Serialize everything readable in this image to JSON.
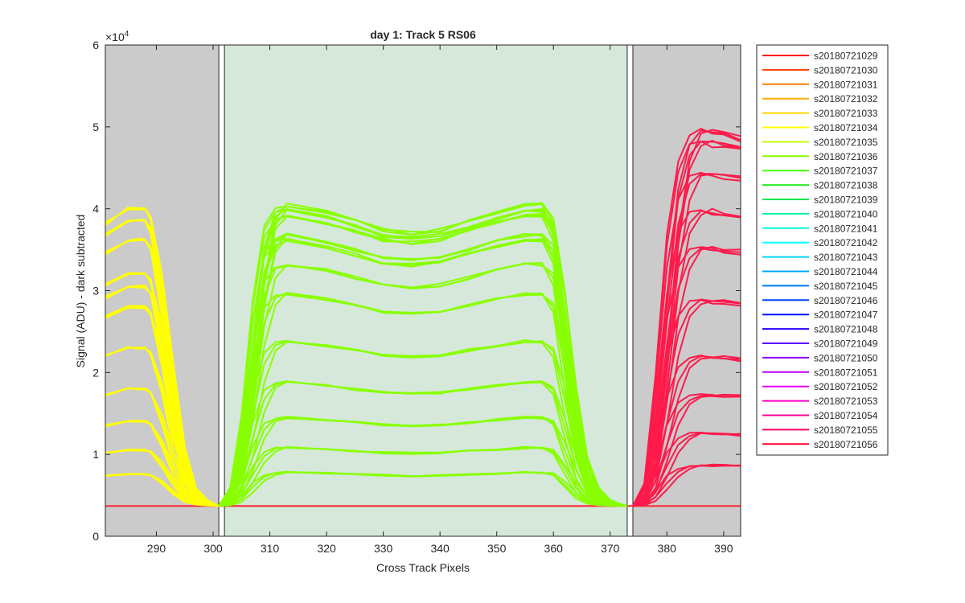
{
  "chart_data": {
    "type": "line",
    "title": "day 1: Track 5  RS06",
    "xlabel": "Cross Track Pixels",
    "ylabel": "Signal (ADU) - dark subtracted",
    "xlim": [
      281,
      393
    ],
    "ylim": [
      0,
      60000
    ],
    "x_ticks": [
      290,
      300,
      310,
      320,
      330,
      340,
      350,
      360,
      370,
      380,
      390
    ],
    "y_ticks": [
      0,
      10000,
      20000,
      30000,
      40000,
      50000,
      60000
    ],
    "y_tick_labels": [
      "0",
      "1",
      "2",
      "3",
      "4",
      "5",
      "6"
    ],
    "y_exponent_base": "×10",
    "y_exponent_power": "4",
    "grid": false,
    "legend_position": "outside-right",
    "background_regions": [
      {
        "x0": 281,
        "x1": 301,
        "color": "#cbcbcb"
      },
      {
        "x0": 302,
        "x1": 373,
        "color": "#d5e8d9"
      },
      {
        "x0": 374,
        "x1": 393,
        "color": "#cbcbcb"
      }
    ],
    "vertical_lines": [
      301,
      302,
      373,
      374
    ],
    "baseline_level": 3700,
    "legend": [
      {
        "name": "s20180721029",
        "color": "#ff0000"
      },
      {
        "name": "s20180721030",
        "color": "#ff4000"
      },
      {
        "name": "s20180721031",
        "color": "#ff7b00"
      },
      {
        "name": "s20180721032",
        "color": "#ffaa00"
      },
      {
        "name": "s20180721033",
        "color": "#ffd500"
      },
      {
        "name": "s20180721034",
        "color": "#ffff00"
      },
      {
        "name": "s20180721035",
        "color": "#c4ff00"
      },
      {
        "name": "s20180721036",
        "color": "#88ff00"
      },
      {
        "name": "s20180721037",
        "color": "#4cff00"
      },
      {
        "name": "s20180721038",
        "color": "#22ee22"
      },
      {
        "name": "s20180721039",
        "color": "#00e64c"
      },
      {
        "name": "s20180721040",
        "color": "#00f5a0"
      },
      {
        "name": "s20180721041",
        "color": "#00ffd5"
      },
      {
        "name": "s20180721042",
        "color": "#00ffff"
      },
      {
        "name": "s20180721043",
        "color": "#00d5ff"
      },
      {
        "name": "s20180721044",
        "color": "#00aaff"
      },
      {
        "name": "s20180721045",
        "color": "#0077ff"
      },
      {
        "name": "s20180721046",
        "color": "#0044ff"
      },
      {
        "name": "s20180721047",
        "color": "#0011ff"
      },
      {
        "name": "s20180721048",
        "color": "#2200ff"
      },
      {
        "name": "s20180721049",
        "color": "#5500ff"
      },
      {
        "name": "s20180721050",
        "color": "#8800ff"
      },
      {
        "name": "s20180721051",
        "color": "#bb00ff"
      },
      {
        "name": "s20180721052",
        "color": "#ee00ff"
      },
      {
        "name": "s20180721053",
        "color": "#ff00cc"
      },
      {
        "name": "s20180721054",
        "color": "#ff0099"
      },
      {
        "name": "s20180721055",
        "color": "#ff0066"
      },
      {
        "name": "s20180721056",
        "color": "#ff0033"
      }
    ],
    "series_groups": [
      {
        "name": "left-group",
        "color": "#ffff00",
        "x": [
          281,
          285,
          287,
          288,
          289,
          291,
          293,
          295,
          297,
          299,
          301
        ],
        "shapes": [
          [
            0.95,
            1.0,
            1.0,
            1.0,
            0.97,
            0.78,
            0.48,
            0.2,
            0.06,
            0.02,
            0.0
          ],
          [
            0.95,
            1.0,
            1.0,
            1.0,
            0.97,
            0.74,
            0.42,
            0.16,
            0.05,
            0.015,
            0.0
          ],
          [
            0.95,
            1.0,
            1.0,
            1.0,
            0.96,
            0.7,
            0.36,
            0.12,
            0.04,
            0.01,
            0.0
          ]
        ],
        "peaks": [
          40000,
          38500,
          36200,
          32100,
          30500,
          28000,
          23000,
          18000,
          14000,
          10500,
          7600
        ],
        "wiggle": 350
      },
      {
        "name": "center-group",
        "color": "#88ff00",
        "x": [
          301,
          303,
          305,
          307,
          309,
          311,
          313,
          320,
          325,
          330,
          335,
          340,
          345,
          350,
          355,
          358,
          360,
          362,
          364,
          366,
          368,
          370,
          372,
          373
        ],
        "shapes": [
          [
            0,
            0.02,
            0.12,
            0.4,
            0.75,
            0.95,
            1.0,
            0.975,
            0.945,
            0.915,
            0.905,
            0.915,
            0.945,
            0.975,
            1.0,
            1.0,
            0.96,
            0.72,
            0.4,
            0.16,
            0.06,
            0.02,
            0.005,
            0
          ],
          [
            0,
            0.04,
            0.2,
            0.55,
            0.86,
            0.98,
            1.0,
            0.975,
            0.945,
            0.915,
            0.905,
            0.915,
            0.945,
            0.975,
            1.0,
            1.0,
            0.94,
            0.64,
            0.3,
            0.1,
            0.035,
            0.01,
            0.003,
            0
          ],
          [
            0,
            0.06,
            0.3,
            0.68,
            0.93,
            0.99,
            1.0,
            0.975,
            0.945,
            0.915,
            0.905,
            0.915,
            0.945,
            0.975,
            1.0,
            1.0,
            0.91,
            0.55,
            0.22,
            0.07,
            0.02,
            0.006,
            0.002,
            0
          ]
        ],
        "peaks": [
          40500,
          39800,
          39200,
          36800,
          36200,
          33200,
          29600,
          23800,
          18800,
          14500,
          10800,
          7800
        ],
        "wiggle": 380
      },
      {
        "name": "right-group",
        "color": "#ff1a4a",
        "x": [
          374,
          376,
          378,
          380,
          382,
          384,
          386,
          388,
          390,
          393
        ],
        "shapes": [
          [
            0,
            0.06,
            0.35,
            0.72,
            0.92,
            0.99,
            1.0,
            0.99,
            0.985,
            0.975
          ],
          [
            0,
            0.03,
            0.22,
            0.55,
            0.84,
            0.96,
            1.0,
            0.995,
            0.99,
            0.98
          ],
          [
            0,
            0.015,
            0.12,
            0.4,
            0.72,
            0.92,
            0.99,
            1.0,
            0.995,
            0.985
          ]
        ],
        "peaks": [
          49500,
          48200,
          44500,
          39800,
          35300,
          28800,
          22000,
          17300,
          12600,
          8700
        ],
        "wiggle": 420
      }
    ]
  }
}
